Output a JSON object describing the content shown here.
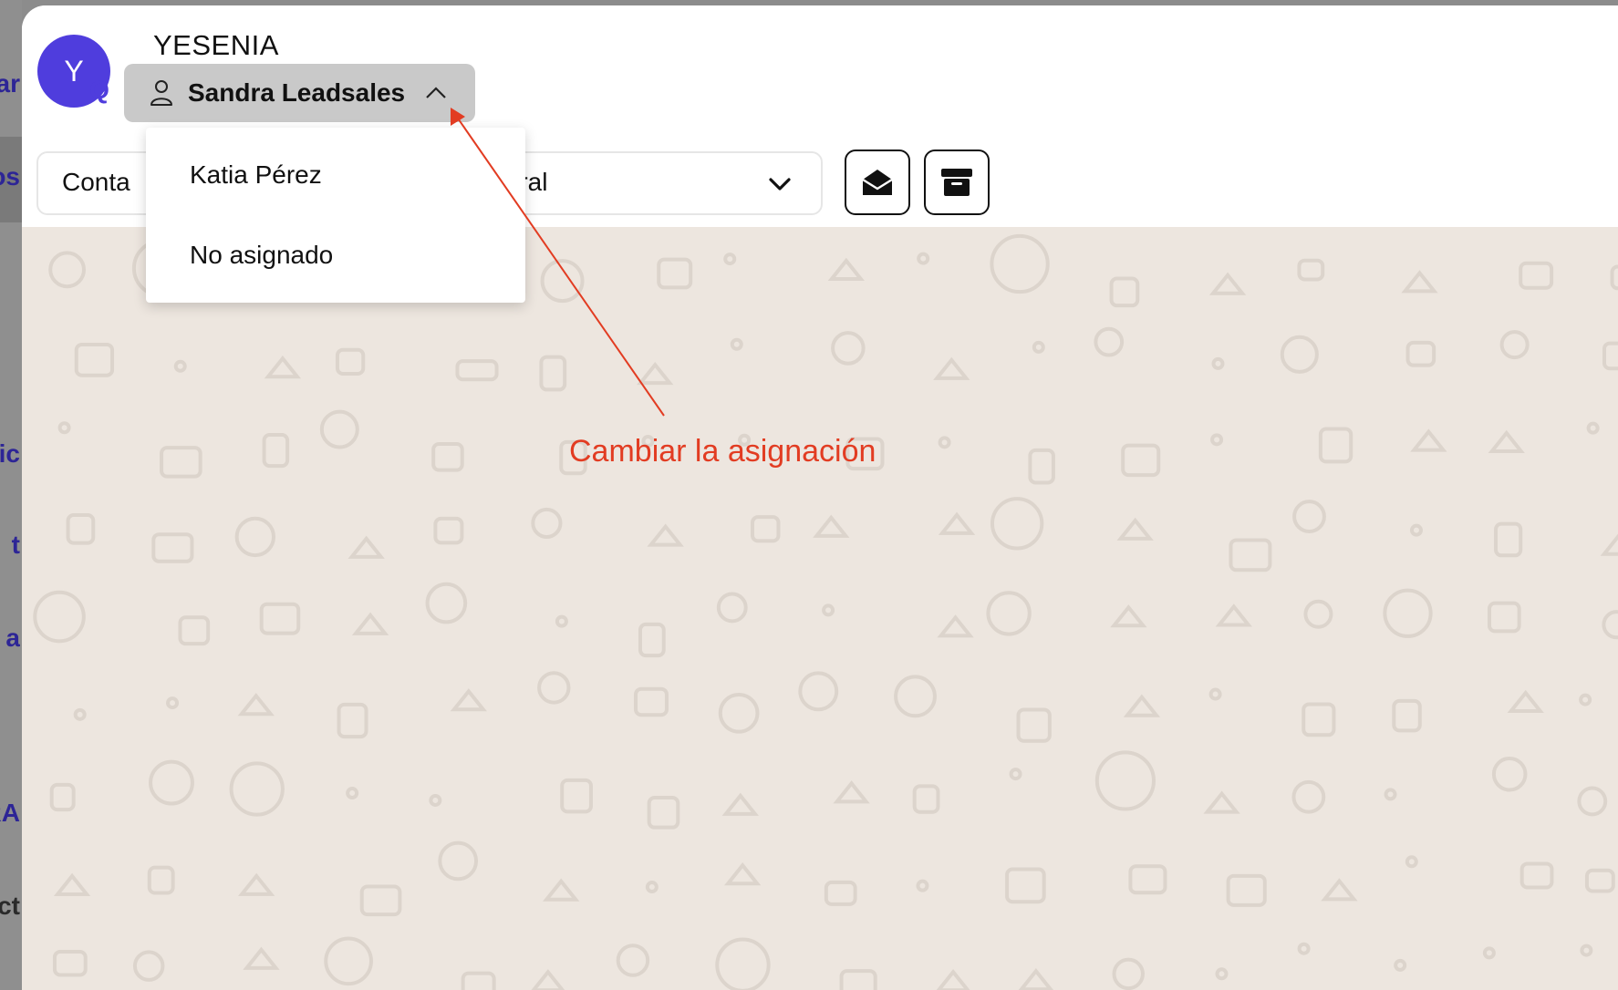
{
  "background_sidebar": {
    "fragments": [
      "ar",
      "os",
      "ric",
      "t",
      "a",
      "RA",
      "ct"
    ]
  },
  "contact": {
    "name": "YESENIA",
    "avatar_initial": "Y",
    "avatar_badge": "Q"
  },
  "assignment": {
    "current_assignee": "Sandra Leadsales",
    "icon": "user-icon",
    "chevron": "chevron-up-icon",
    "options": [
      "Katia Pérez",
      "No asignado"
    ]
  },
  "stage_select": {
    "left_text": "Conta",
    "value_visible": "utral",
    "chevron": "chevron-down-icon"
  },
  "actions": {
    "mark_read_icon": "envelope-open-icon",
    "archive_icon": "archive-icon"
  },
  "annotation": {
    "text": "Cambiar la asignación",
    "color": "#e23c22"
  },
  "colors": {
    "accent": "#4f3ddd",
    "chat_bg": "#ede6df",
    "assign_bg": "#c9c9c9"
  }
}
